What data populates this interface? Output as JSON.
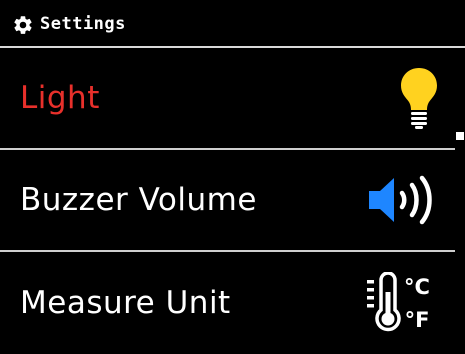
{
  "header": {
    "title": "Settings",
    "icon": "gear-icon"
  },
  "menu": {
    "items": [
      {
        "label": "Light",
        "icon": "lightbulb-icon",
        "selected": true
      },
      {
        "label": "Buzzer Volume",
        "icon": "speaker-volume-icon",
        "selected": false
      },
      {
        "label": "Measure Unit",
        "icon": "thermometer-unit-icon",
        "selected": false
      }
    ]
  },
  "unit_icon": {
    "celsius": "°C",
    "fahrenheit": "°F"
  },
  "colors": {
    "background": "#000000",
    "selected_text": "#e8302b",
    "text": "#ffffff",
    "bulb": "#ffd21f",
    "speaker": "#1e86ff",
    "divider": "#cfcfcf"
  }
}
